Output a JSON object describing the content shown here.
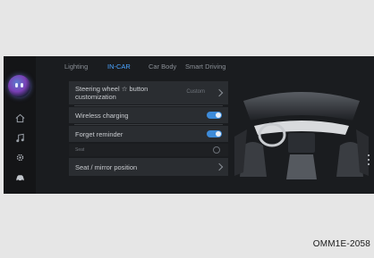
{
  "tabs": [
    {
      "label": "Lighting",
      "active": false
    },
    {
      "label": "IN-CAR",
      "active": true
    },
    {
      "label": "Car Body",
      "active": false
    },
    {
      "label": "Smart Driving",
      "active": false
    }
  ],
  "rows": {
    "steering": {
      "label_line1": "Steering wheel ☆ button",
      "label_line2": "customization",
      "value": "Custom"
    },
    "wireless": {
      "label": "Wireless charging",
      "on": true
    },
    "forget": {
      "label": "Forget reminder",
      "on": true
    },
    "seat_small": {
      "label": "Seat"
    },
    "seat_mirror": {
      "label": "Seat / mirror position"
    }
  },
  "rail_icons": [
    "assistant-icon",
    "home-icon",
    "music-icon",
    "settings-icon",
    "car-icon"
  ],
  "caption": "OMM1E-2058",
  "colors": {
    "accent": "#4aa3ff",
    "toggle_on": "#3d8bd9",
    "screen_bg": "#1a1c1f",
    "page_bg": "#e6e6e6"
  }
}
